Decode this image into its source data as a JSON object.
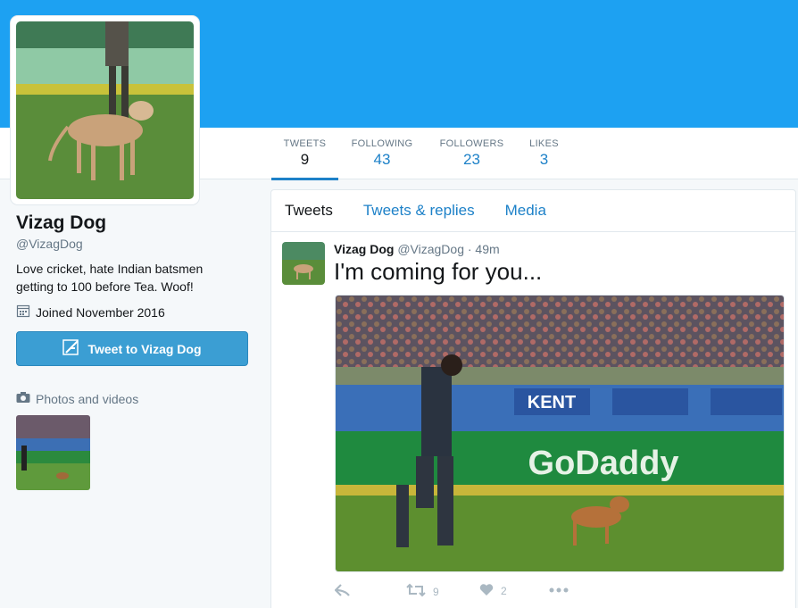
{
  "profile": {
    "name": "Vizag Dog",
    "handle": "@VizagDog",
    "bio": "Love cricket, hate Indian batsmen getting to 100 before Tea. Woof!",
    "joined": "Joined November 2016",
    "tweet_to_label": "Tweet to Vizag Dog",
    "photos_label": "Photos and videos"
  },
  "stats": [
    {
      "label": "TWEETS",
      "value": "9"
    },
    {
      "label": "FOLLOWING",
      "value": "43"
    },
    {
      "label": "FOLLOWERS",
      "value": "23"
    },
    {
      "label": "LIKES",
      "value": "3"
    }
  ],
  "tabs": [
    {
      "label": "Tweets"
    },
    {
      "label": "Tweets & replies"
    },
    {
      "label": "Media"
    }
  ],
  "tweet": {
    "name": "Vizag Dog",
    "handle": "@VizagDog",
    "time": "· 49m",
    "text": "I'm coming for you...",
    "retweets": "9",
    "likes": "2"
  },
  "banner_ads": {
    "sponsor": "GoDaddy",
    "board": "KENT"
  },
  "colors": {
    "header": "#1da1f2",
    "link": "#1d81c8",
    "button": "#3b9ed3"
  }
}
